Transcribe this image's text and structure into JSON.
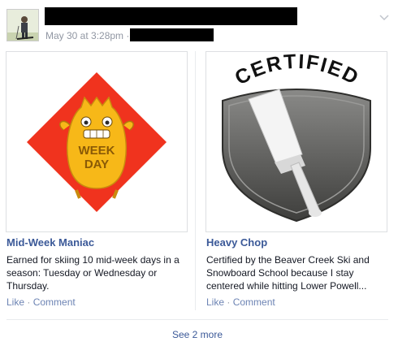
{
  "post": {
    "timestamp": "May 30 at 3:28pm ·"
  },
  "cards": [
    {
      "title": "Mid-Week Maniac",
      "description": "Earned for skiing 10 mid-week days in a season: Tuesday or Wednesday or Thursday.",
      "badge_text_line1": "WEEK",
      "badge_text_line2": "DAY",
      "like_label": "Like",
      "separator": "·",
      "comment_label": "Comment",
      "badge_colors": {
        "diamond": "#f0331e",
        "creature": "#f7b818"
      }
    },
    {
      "title": "Heavy Chop",
      "description": "Certified by the Beaver Creek Ski and Snowboard School because I stay centered while hitting Lower Powell...",
      "badge_arc_text": "CERTIFIED",
      "like_label": "Like",
      "separator": "·",
      "comment_label": "Comment",
      "badge_colors": {
        "shield": "#5a5a58",
        "cleaver": "#f4f4f4"
      }
    }
  ],
  "footer": {
    "see_more_label": "See 2 more"
  }
}
